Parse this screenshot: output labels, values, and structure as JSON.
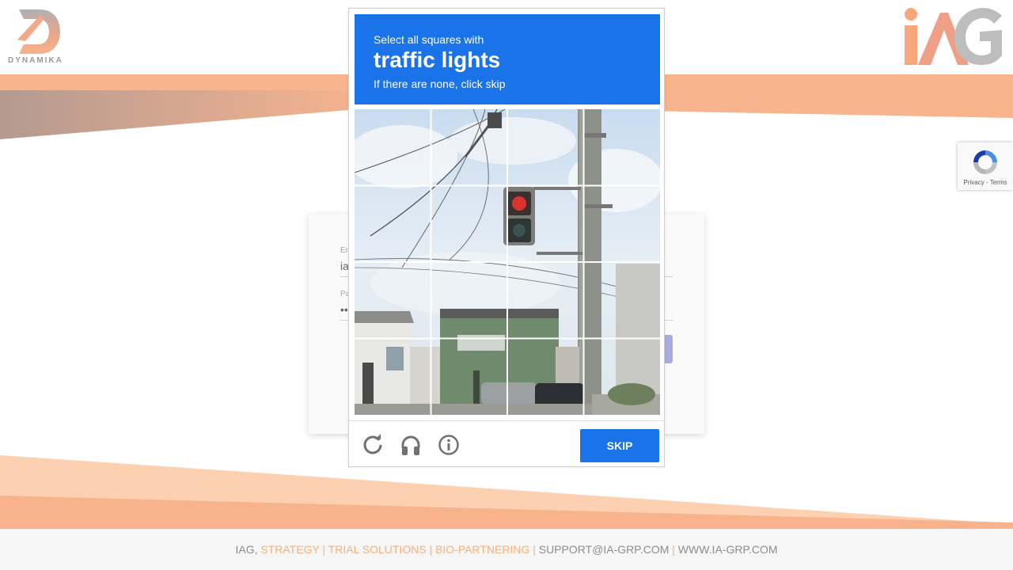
{
  "header": {
    "left_logo_text": "DYNAMIKA",
    "left_logo_icon": "dynamika-d-logo",
    "right_logo_icon": "iag-logo"
  },
  "login": {
    "email_label": "Em",
    "email_value": "ia",
    "password_label": "Pa",
    "password_value": "••"
  },
  "captcha": {
    "instruction_line1": "Select all squares with",
    "target": "traffic lights",
    "instruction_line3": "If there are none, click skip",
    "grid_size": 4,
    "reload_icon": "reload-icon",
    "audio_icon": "headphones-icon",
    "info_icon": "info-icon",
    "skip_label": "Skip",
    "accent_color": "#1a73e8"
  },
  "badge": {
    "text": "Privacy - Terms"
  },
  "footer": {
    "prefix": "IAG, ",
    "highlight": "STRATEGY | TRIAL SOLUTIONS | BIO-PARTNERING | ",
    "email": "SUPPORT@IA-GRP.COM",
    "separator": " | ",
    "website": "WWW.IA-GRP.COM"
  },
  "colors": {
    "brand_orange": "#f5b07a",
    "footer_bg": "#f6f6f6"
  }
}
